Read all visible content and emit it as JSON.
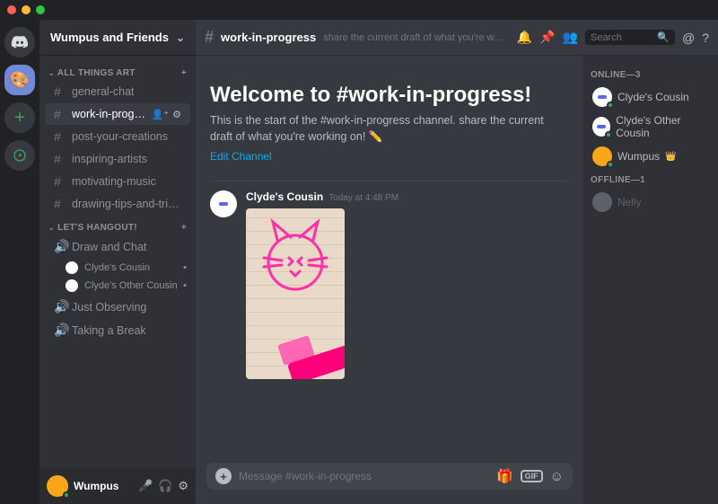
{
  "server": {
    "name": "Wumpus and Friends"
  },
  "categories": [
    {
      "name": "ALL THINGS ART",
      "channels": [
        {
          "type": "text",
          "name": "general-chat"
        },
        {
          "type": "text",
          "name": "work-in-progress",
          "selected": true
        },
        {
          "type": "text",
          "name": "post-your-creations"
        },
        {
          "type": "text",
          "name": "inspiring-artists"
        },
        {
          "type": "text",
          "name": "motivating-music"
        },
        {
          "type": "text",
          "name": "drawing-tips-and-tricks"
        }
      ]
    },
    {
      "name": "LET'S HANGOUT!",
      "channels": [
        {
          "type": "voice",
          "name": "Draw and Chat",
          "users": [
            "Clyde's Cousin",
            "Clyde's Other Cousin"
          ]
        },
        {
          "type": "voice",
          "name": "Just Observing"
        },
        {
          "type": "voice",
          "name": "Taking a Break"
        }
      ]
    }
  ],
  "current_user": {
    "name": "Wumpus"
  },
  "topbar": {
    "channel": "work-in-progress",
    "topic": "share the current draft of what you're working on…",
    "search_placeholder": "Search"
  },
  "welcome": {
    "title": "Welcome to #work-in-progress!",
    "subtitle": "This is the start of the #work-in-progress channel. share the current draft of what you're working on! ✏️",
    "edit": "Edit Channel"
  },
  "message": {
    "author": "Clyde's Cousin",
    "timestamp": "Today at 4:48 PM"
  },
  "composer": {
    "placeholder": "Message #work-in-progress"
  },
  "memberlist": {
    "online": {
      "label": "ONLINE—3",
      "members": [
        "Clyde's Cousin",
        "Clyde's Other Cousin",
        "Wumpus"
      ]
    },
    "offline": {
      "label": "OFFLINE—1",
      "members": [
        "Nelly"
      ]
    }
  }
}
